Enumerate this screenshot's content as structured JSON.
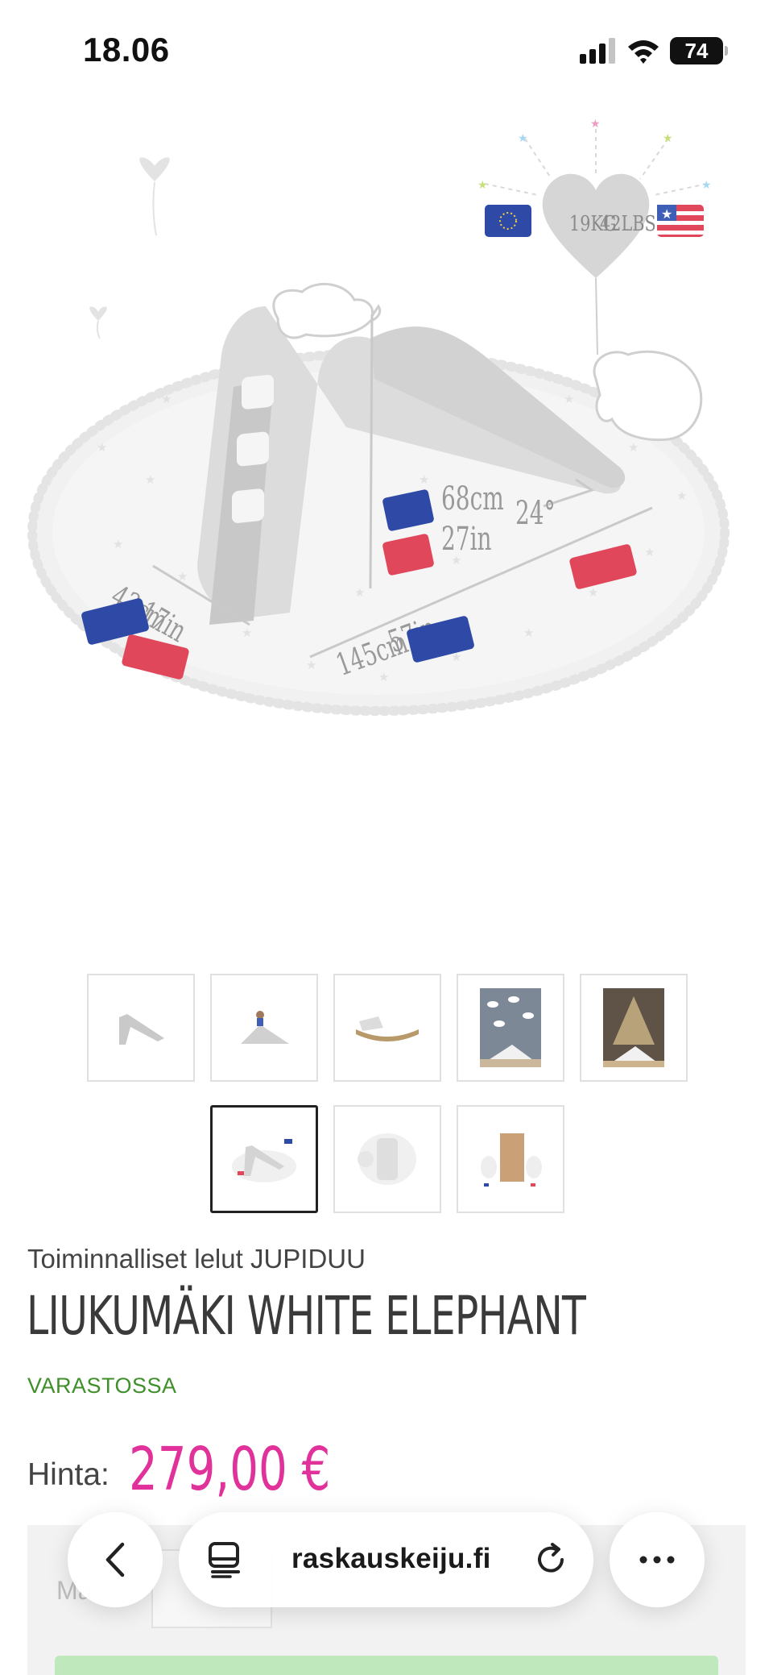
{
  "status_bar": {
    "time": "18.06",
    "battery": "74"
  },
  "product_image": {
    "eu_weight": "19KG",
    "us_weight": "42LBS",
    "height_cm": "68cm",
    "height_in": "27in",
    "angle": "24°",
    "width_cm": "43cm",
    "width_in": "17in",
    "length_cm": "145cm",
    "length_in": "57in"
  },
  "thumbnails": [
    {
      "name": "slide-side-view"
    },
    {
      "name": "slide-with-child"
    },
    {
      "name": "slide-rocker"
    },
    {
      "name": "slide-room-clouds"
    },
    {
      "name": "slide-room-tent"
    },
    {
      "name": "slide-dimensions"
    },
    {
      "name": "slide-top-view"
    },
    {
      "name": "slide-packaging"
    }
  ],
  "product": {
    "category": "Toiminnalliset lelut JUPIDUU",
    "title": "LIUKUMÄKI WHITE ELEPHANT",
    "stock": "VARASTOSSA",
    "price_label": "Hinta:",
    "price": "279,00 €",
    "quantity_label": "Ma"
  },
  "browser": {
    "url": "raskauskeiju.fi"
  },
  "colors": {
    "accent_price": "#e0329a",
    "stock_green": "#3f8f2a",
    "eu_blue": "#2f4aa6",
    "us_red": "#e0475a"
  }
}
